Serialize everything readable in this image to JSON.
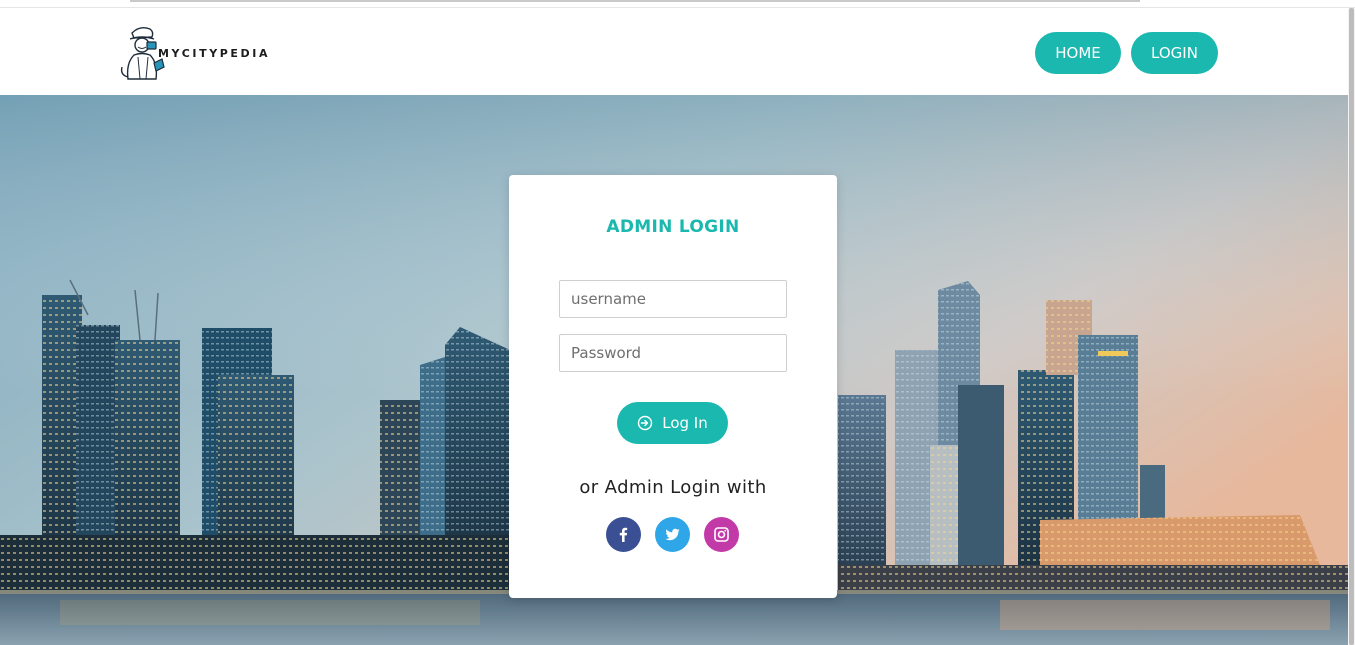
{
  "brand": {
    "name": "MYCITYPEDIA",
    "accent": "#1ab8ae"
  },
  "nav": {
    "home_label": "HOME",
    "login_label": "LOGIN"
  },
  "login_card": {
    "title": "ADMIN LOGIN",
    "username_placeholder": "username",
    "password_placeholder": "Password",
    "submit_label": "Log In",
    "alt_text": "or Admin Login with"
  },
  "social": [
    {
      "icon": "facebook-icon",
      "color": "#3b4f94"
    },
    {
      "icon": "twitter-icon",
      "color": "#2ea6e8"
    },
    {
      "icon": "instagram-icon",
      "color": "#c23aa8"
    }
  ]
}
